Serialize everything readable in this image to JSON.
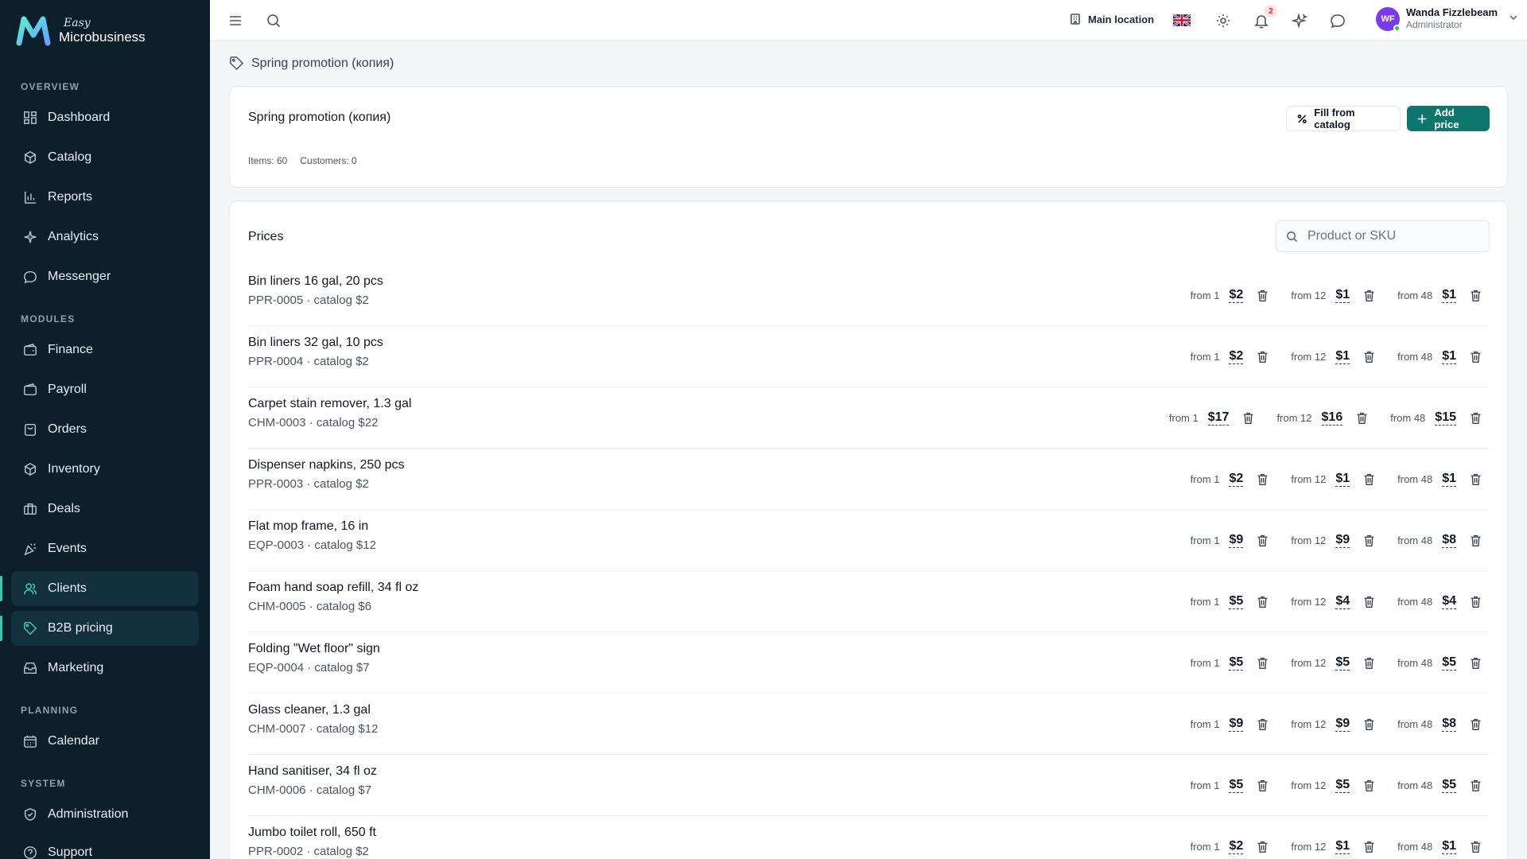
{
  "app": {
    "logo_small": "Easy",
    "logo_name": "Microbusiness"
  },
  "sidebar": {
    "sections": [
      {
        "title": "OVERVIEW",
        "items": [
          {
            "label": "Dashboard",
            "icon": "dashboard-icon"
          },
          {
            "label": "Catalog",
            "icon": "catalog-icon"
          },
          {
            "label": "Reports",
            "icon": "reports-icon"
          },
          {
            "label": "Analytics",
            "icon": "analytics-icon"
          },
          {
            "label": "Messenger",
            "icon": "messenger-icon"
          }
        ]
      },
      {
        "title": "MODULES",
        "items": [
          {
            "label": "Finance",
            "icon": "finance-icon"
          },
          {
            "label": "Payroll",
            "icon": "payroll-icon"
          },
          {
            "label": "Orders",
            "icon": "orders-icon"
          },
          {
            "label": "Inventory",
            "icon": "inventory-icon"
          },
          {
            "label": "Deals",
            "icon": "deals-icon"
          },
          {
            "label": "Events",
            "icon": "events-icon"
          },
          {
            "label": "Clients",
            "icon": "clients-icon",
            "active": true
          },
          {
            "label": "B2B pricing",
            "icon": "tag-icon",
            "active": true
          },
          {
            "label": "Marketing",
            "icon": "marketing-icon"
          }
        ]
      },
      {
        "title": "PLANNING",
        "items": [
          {
            "label": "Calendar",
            "icon": "calendar-icon"
          }
        ]
      },
      {
        "title": "SYSTEM",
        "items": [
          {
            "label": "Administration",
            "icon": "shield-icon"
          },
          {
            "label": "Support",
            "icon": "support-icon"
          }
        ]
      }
    ]
  },
  "topbar": {
    "location": "Main location",
    "notifications_count": "2",
    "user_initials": "WF",
    "user_name": "Wanda Fizzlebeam",
    "user_role": "Administrator"
  },
  "breadcrumb": "Spring promotion (копия)",
  "header": {
    "title": "Spring promotion (копия)",
    "items_stat": "Items: 60",
    "customers_stat": "Customers: 0",
    "fill_button": "Fill from catalog",
    "add_button": "Add price"
  },
  "prices": {
    "title": "Prices",
    "search_placeholder": "Product or SKU",
    "rows": [
      {
        "name": "Bin liners 16 gal, 20 pcs",
        "sub": "PPR-0005 · catalog $2",
        "tiers": [
          [
            "from 1",
            "$2"
          ],
          [
            "from 12",
            "$1"
          ],
          [
            "from 48",
            "$1"
          ]
        ]
      },
      {
        "name": "Bin liners 32 gal, 10 pcs",
        "sub": "PPR-0004 · catalog $2",
        "tiers": [
          [
            "from 1",
            "$2"
          ],
          [
            "from 12",
            "$1"
          ],
          [
            "from 48",
            "$1"
          ]
        ]
      },
      {
        "name": "Carpet stain remover, 1.3 gal",
        "sub": "CHM-0003 · catalog $22",
        "tiers": [
          [
            "from 1",
            "$17"
          ],
          [
            "from 12",
            "$16"
          ],
          [
            "from 48",
            "$15"
          ]
        ]
      },
      {
        "name": "Dispenser napkins, 250 pcs",
        "sub": "PPR-0003 · catalog $2",
        "tiers": [
          [
            "from 1",
            "$2"
          ],
          [
            "from 12",
            "$1"
          ],
          [
            "from 48",
            "$1"
          ]
        ]
      },
      {
        "name": "Flat mop frame, 16 in",
        "sub": "EQP-0003 · catalog $12",
        "tiers": [
          [
            "from 1",
            "$9"
          ],
          [
            "from 12",
            "$9"
          ],
          [
            "from 48",
            "$8"
          ]
        ]
      },
      {
        "name": "Foam hand soap refill, 34 fl oz",
        "sub": "CHM-0005 · catalog $6",
        "tiers": [
          [
            "from 1",
            "$5"
          ],
          [
            "from 12",
            "$4"
          ],
          [
            "from 48",
            "$4"
          ]
        ]
      },
      {
        "name": "Folding \"Wet floor\" sign",
        "sub": "EQP-0004 · catalog $7",
        "tiers": [
          [
            "from 1",
            "$5"
          ],
          [
            "from 12",
            "$5"
          ],
          [
            "from 48",
            "$5"
          ]
        ]
      },
      {
        "name": "Glass cleaner, 1.3 gal",
        "sub": "CHM-0007 · catalog $12",
        "tiers": [
          [
            "from 1",
            "$9"
          ],
          [
            "from 12",
            "$9"
          ],
          [
            "from 48",
            "$8"
          ]
        ]
      },
      {
        "name": "Hand sanitiser, 34 fl oz",
        "sub": "CHM-0006 · catalog $7",
        "tiers": [
          [
            "from 1",
            "$5"
          ],
          [
            "from 12",
            "$5"
          ],
          [
            "from 48",
            "$5"
          ]
        ]
      },
      {
        "name": "Jumbo toilet roll, 650 ft",
        "sub": "PPR-0002 · catalog $2",
        "tiers": [
          [
            "from 1",
            "$2"
          ],
          [
            "from 12",
            "$1"
          ],
          [
            "from 48",
            "$1"
          ]
        ]
      }
    ]
  }
}
